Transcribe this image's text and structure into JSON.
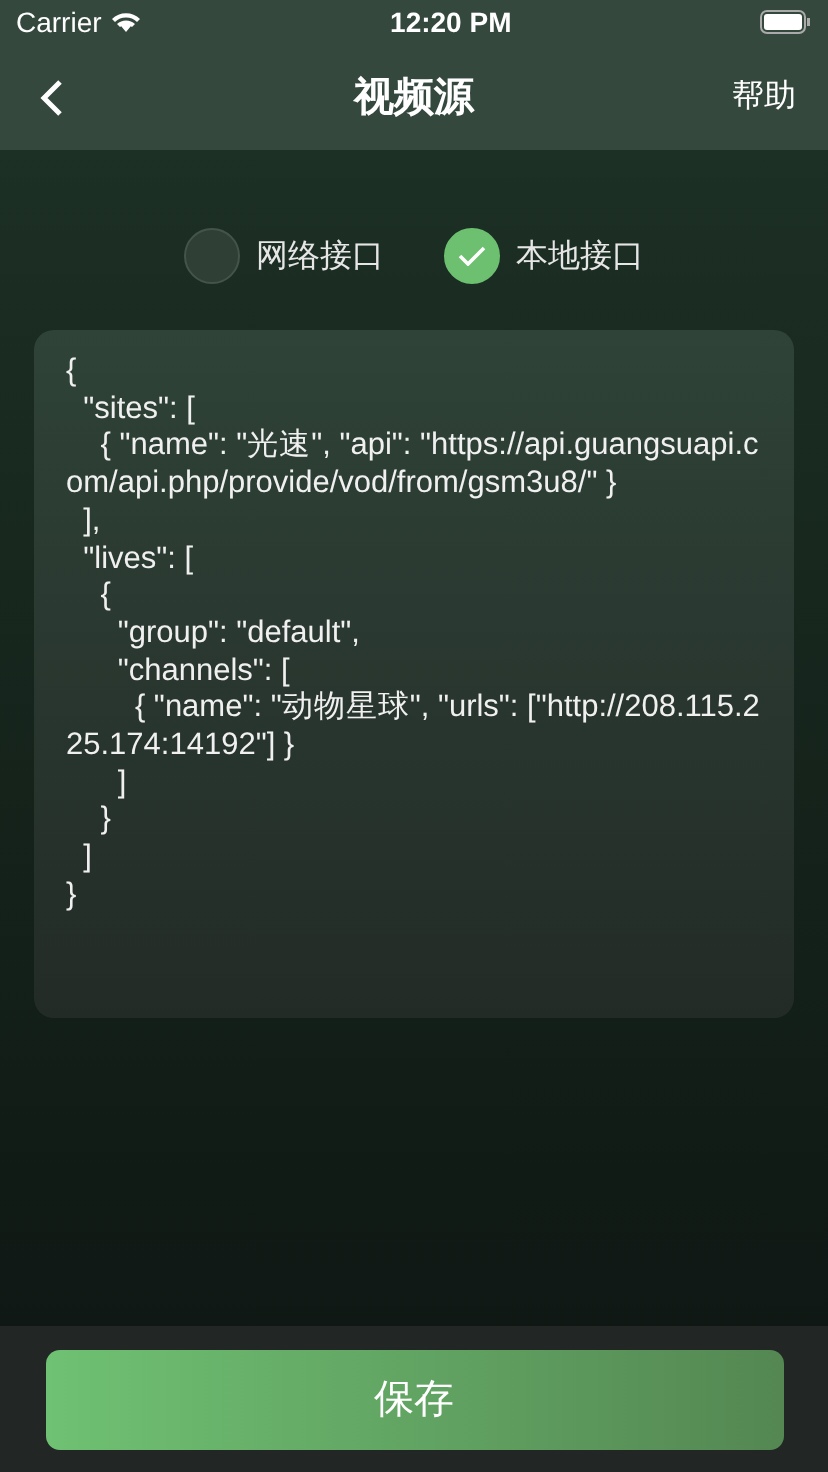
{
  "status_bar": {
    "carrier": "Carrier",
    "time": "12:20 PM"
  },
  "nav": {
    "title": "视频源",
    "action": "帮助"
  },
  "source_options": [
    {
      "label": "网络接口",
      "selected": false
    },
    {
      "label": "本地接口",
      "selected": true
    }
  ],
  "editor": {
    "value": "{\n  \"sites\": [\n    { \"name\": \"光速\", \"api\": \"https://api.guangsuapi.com/api.php/provide/vod/from/gsm3u8/\" }\n  ],\n  \"lives\": [\n    {\n      \"group\": \"default\",\n      \"channels\": [\n        { \"name\": \"动物星球\", \"urls\": [\"http://208.115.225.174:14192\"] }\n      ]\n    }\n  ]\n}"
  },
  "save_button": "保存"
}
